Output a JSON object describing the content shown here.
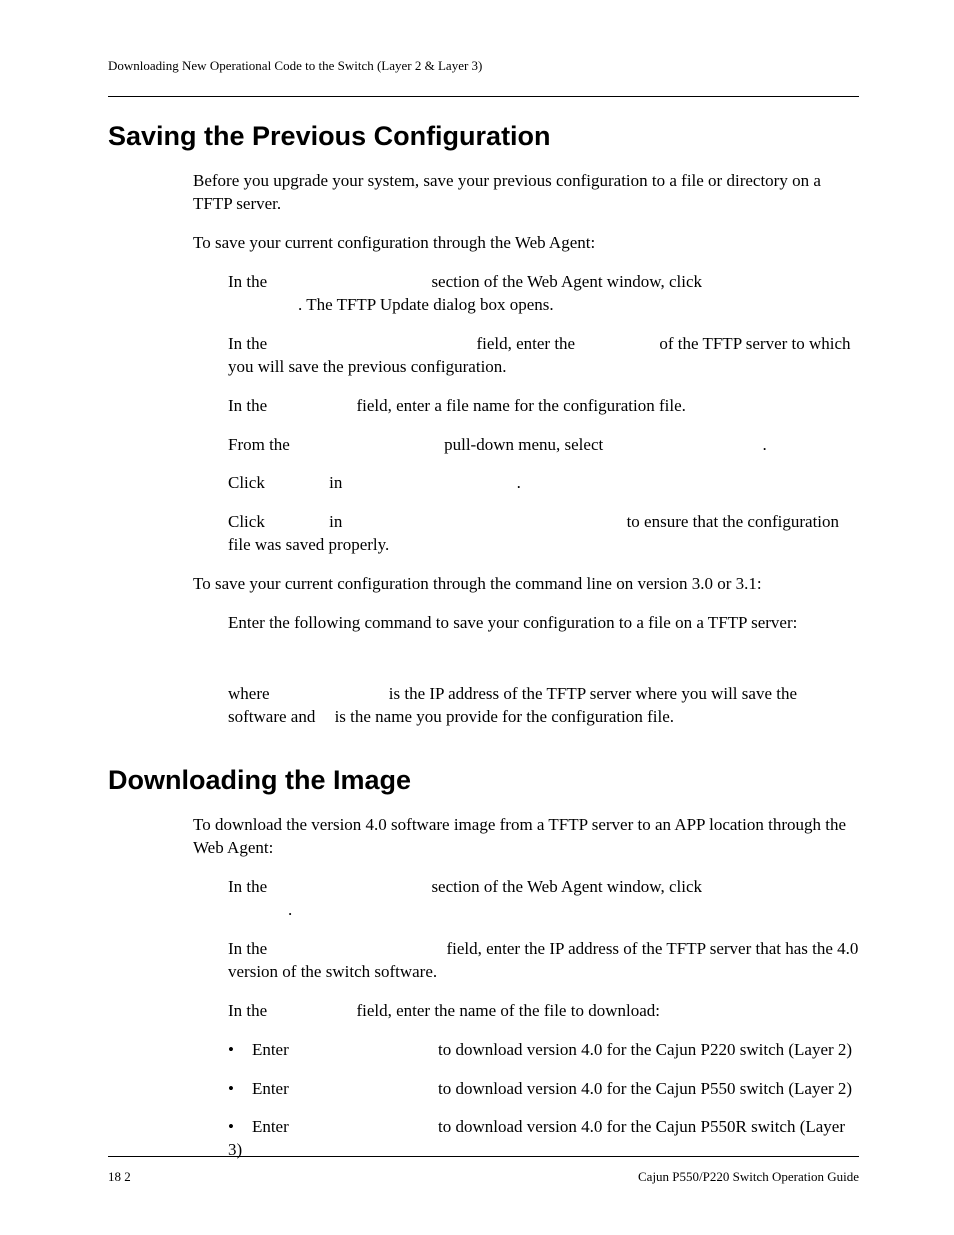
{
  "header": {
    "running": "Downloading New Operational Code to the Switch (Layer 2 & Layer 3)"
  },
  "section1": {
    "title": "Saving the Previous Configuration",
    "p1": "Before you upgrade your system, save your previous configuration to a file or directory on a TFTP server.",
    "p2": "To save your current configuration through the Web Agent:",
    "steps": {
      "s1a": "In the",
      "s1b": "section of the Web Agent window, click",
      "s1c": ". The TFTP Update dialog box opens.",
      "s2a": "In the",
      "s2b": "field, enter the",
      "s2c": "of the TFTP server to which you will save the previous configuration.",
      "s3a": "In the",
      "s3b": "field, enter a file name for the configuration file.",
      "s4a": "From the",
      "s4b": "pull-down menu, select",
      "s4c": ".",
      "s5a": "Click",
      "s5b": "in",
      "s5c": ".",
      "s6a": "Click",
      "s6b": "in",
      "s6c": "to ensure that the configuration file was saved properly."
    },
    "p3": "To save your current configuration through the command line on version 3.0 or 3.1:",
    "cli": {
      "line1": "Enter the following command to save your configuration to a file on a TFTP server:",
      "line2a": "where",
      "line2b": "is the IP address of the TFTP server where you will save the software and",
      "line2c": "is the name you provide for the configuration file."
    }
  },
  "section2": {
    "title": "Downloading the Image",
    "p1": "To download the version 4.0 software image from a TFTP server to an APP location through the Web Agent:",
    "steps": {
      "s1a": "In the",
      "s1b": "section of the Web Agent window, click",
      "s1c": ".",
      "s2a": "In the",
      "s2b": "field, enter the IP address of the TFTP server that has the 4.0 version of the switch software.",
      "s3a": "In the",
      "s3b": "field, enter the name of the file to download:",
      "b1a": "Enter",
      "b1b": "to download version 4.0 for the Cajun P220 switch (Layer 2)",
      "b2a": "Enter",
      "b2b": "to download version 4.0 for the Cajun P550 switch (Layer 2)",
      "b3a": "Enter",
      "b3b": "to download version 4.0 for the Cajun P550R switch (Layer 3)"
    }
  },
  "footer": {
    "left": "18 2",
    "right": "Cajun P550/P220 Switch Operation Guide"
  }
}
